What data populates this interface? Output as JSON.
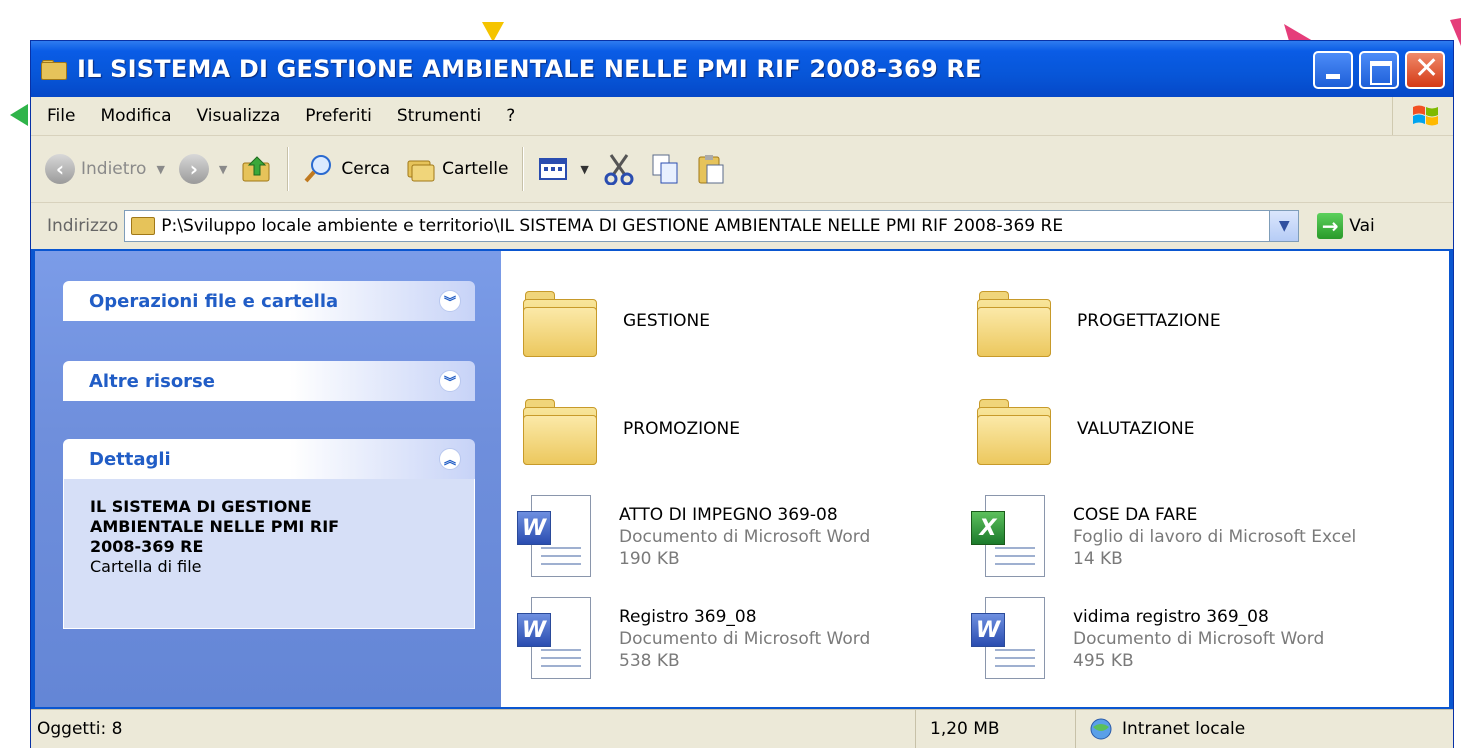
{
  "window": {
    "title": "IL SISTEMA DI GESTIONE AMBIENTALE NELLE PMI RIF 2008-369 RE"
  },
  "menu": [
    "File",
    "Modifica",
    "Visualizza",
    "Preferiti",
    "Strumenti",
    "?"
  ],
  "toolbar": {
    "back_label": "Indietro",
    "search_label": "Cerca",
    "folders_label": "Cartelle"
  },
  "address": {
    "label": "Indirizzo",
    "value": "P:\\Sviluppo locale ambiente e territorio\\IL SISTEMA DI GESTIONE AMBIENTALE NELLE PMI RIF 2008-369 RE",
    "go_label": "Vai"
  },
  "sidebar": {
    "panels": [
      {
        "title": "Operazioni file e cartella",
        "state": "collapsed"
      },
      {
        "title": "Altre risorse",
        "state": "collapsed"
      },
      {
        "title": "Dettagli",
        "state": "expanded"
      }
    ],
    "details": {
      "name": "IL SISTEMA DI GESTIONE AMBIENTALE NELLE PMI RIF 2008-369 RE",
      "type": "Cartella di file"
    }
  },
  "items": [
    {
      "name": "GESTIONE",
      "kind": "folder"
    },
    {
      "name": "PROGETTAZIONE",
      "kind": "folder"
    },
    {
      "name": "PROMOZIONE",
      "kind": "folder"
    },
    {
      "name": "VALUTAZIONE",
      "kind": "folder"
    },
    {
      "name": "ATTO DI IMPEGNO 369-08",
      "kind": "word",
      "type": "Documento di Microsoft Word",
      "size": "190 KB"
    },
    {
      "name": "COSE DA FARE",
      "kind": "excel",
      "type": "Foglio di lavoro di Microsoft Excel",
      "size": "14 KB"
    },
    {
      "name": "Registro 369_08",
      "kind": "word",
      "type": "Documento di Microsoft Word",
      "size": "538 KB"
    },
    {
      "name": "vidima registro 369_08",
      "kind": "word",
      "type": "Documento di Microsoft Word",
      "size": "495 KB"
    }
  ],
  "status": {
    "objects": "Oggetti: 8",
    "size": "1,20 MB",
    "zone": "Intranet locale"
  },
  "colors": {
    "titlebar": "#0a56d0",
    "sidebar": "#6f8fdc",
    "marker_yellow": "#f5c400",
    "marker_green": "#2fb44a",
    "marker_pink": "#e53d7a"
  }
}
